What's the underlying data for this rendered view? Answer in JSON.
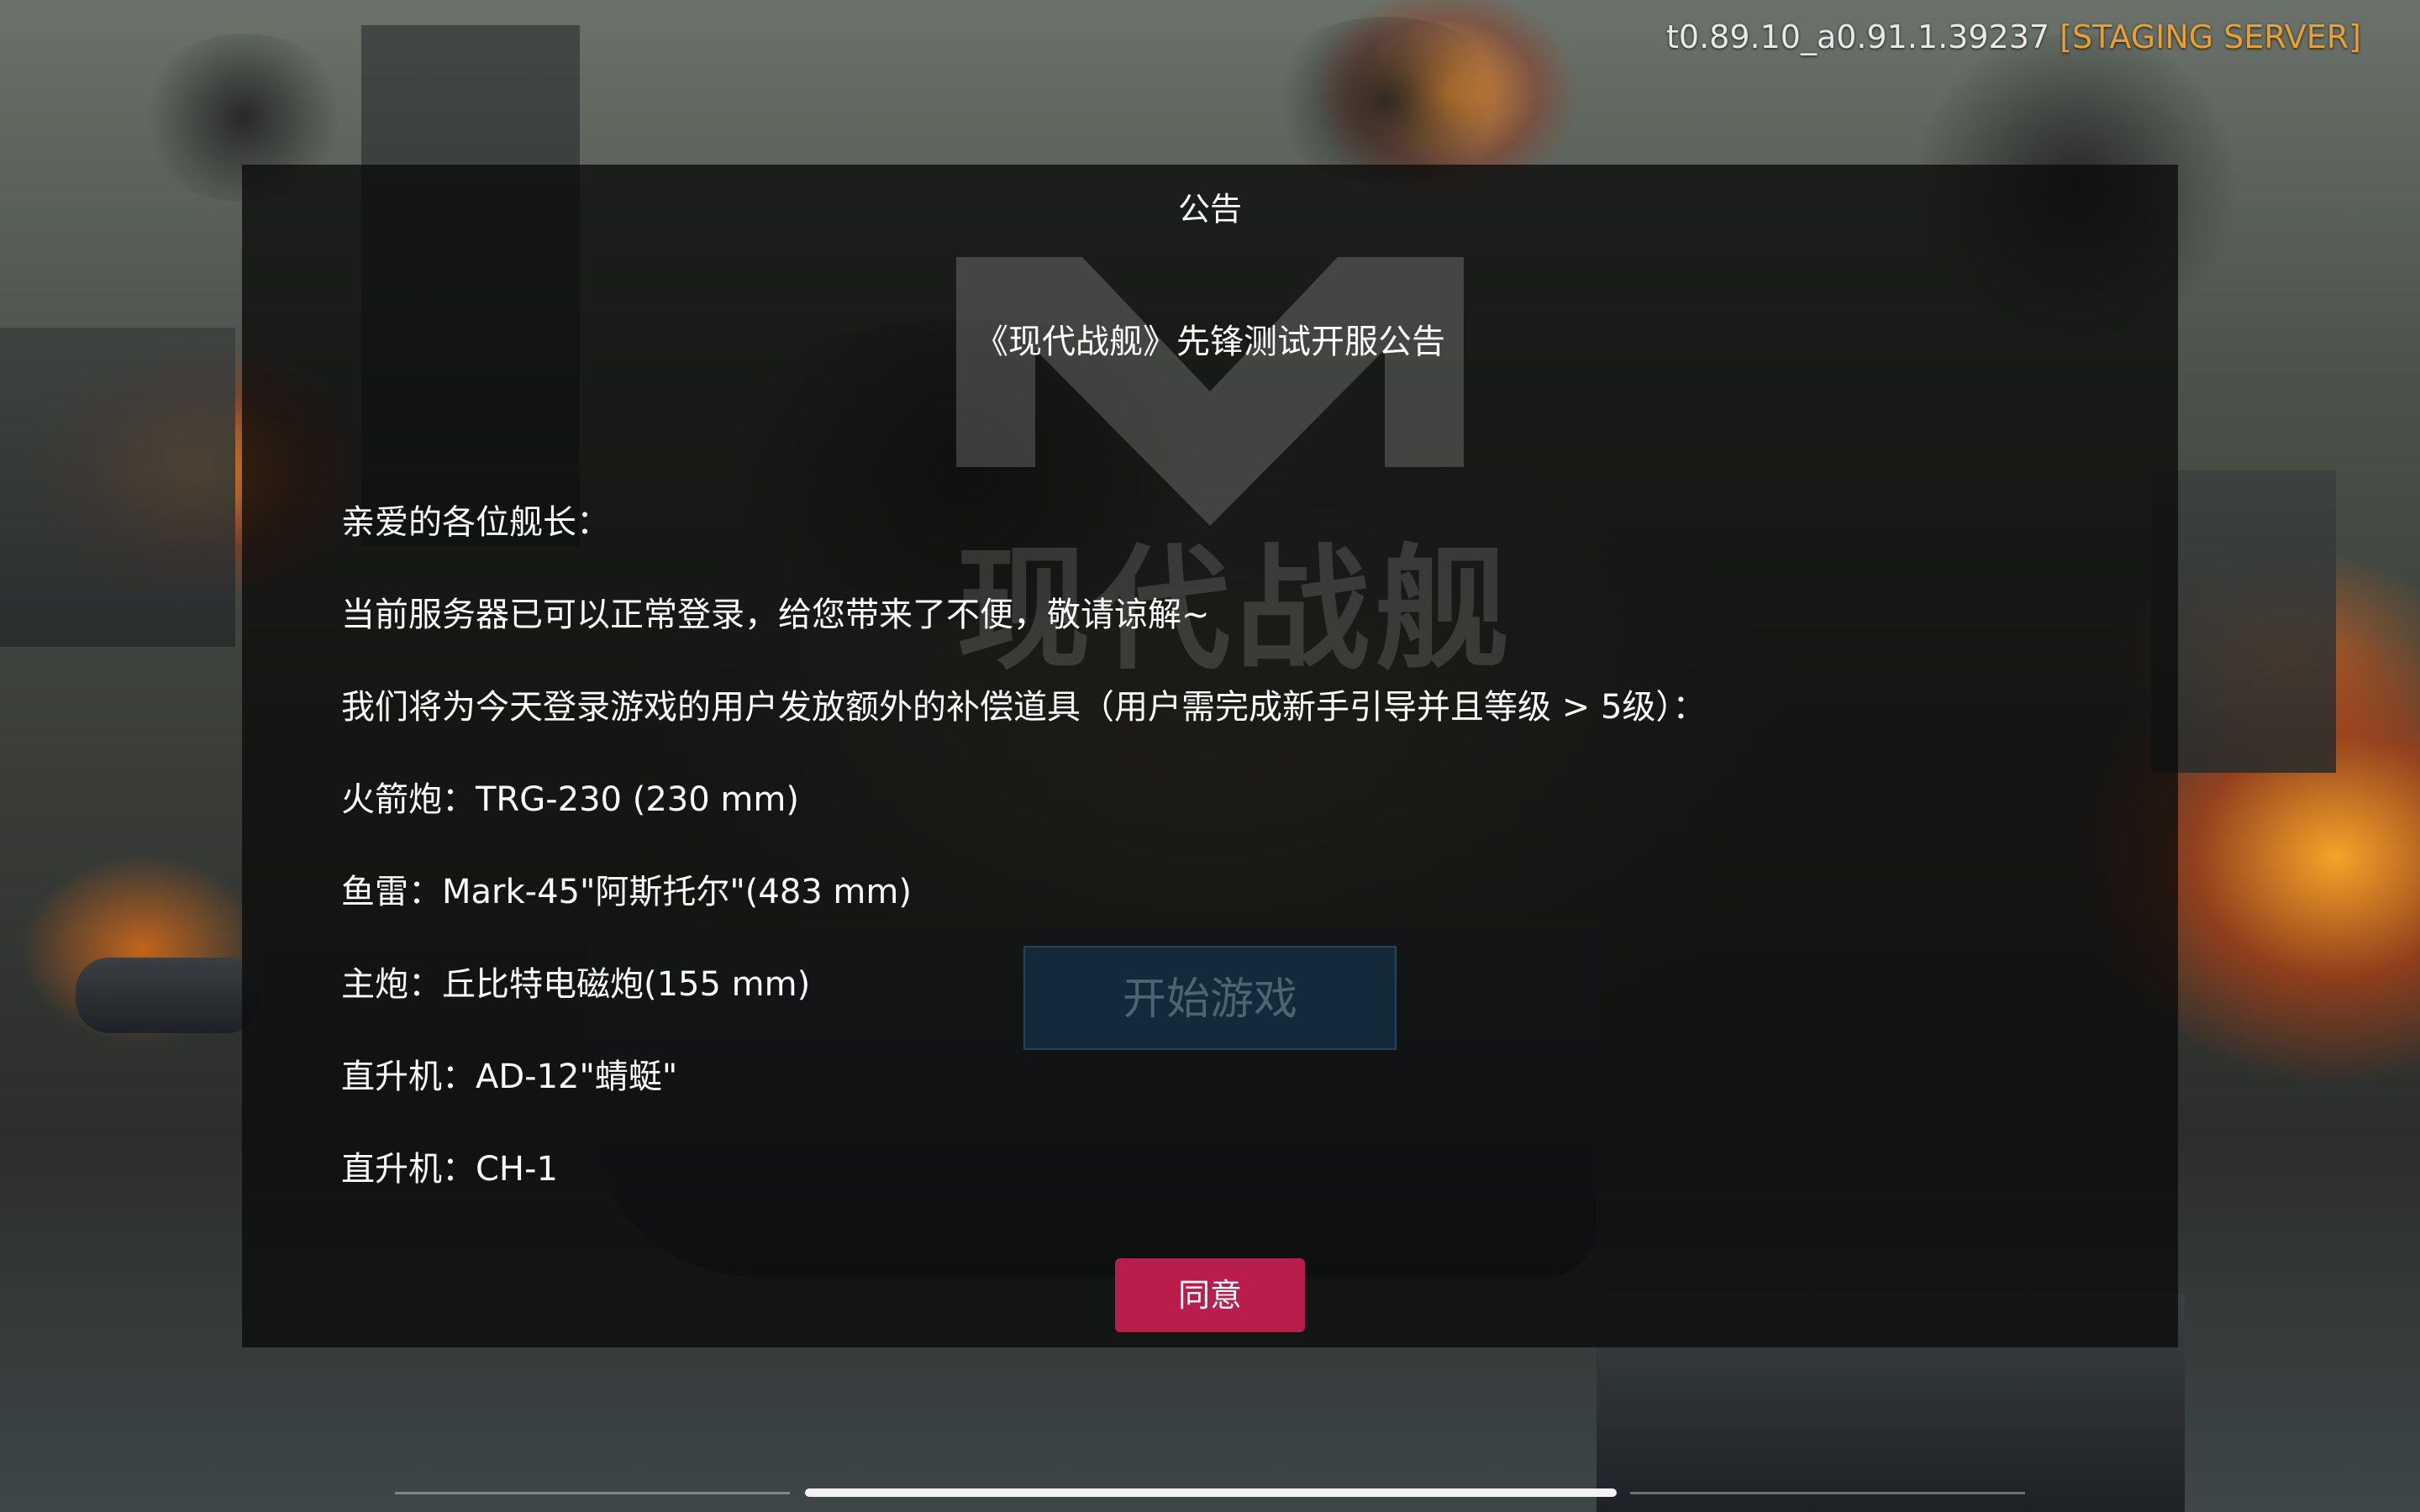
{
  "version": {
    "build": "t0.89.10_a0.91.1.39237",
    "server_tag": "[STAGING SERVER]"
  },
  "background": {
    "logo_text": "现代战舰",
    "start_button_label": "开始游戏"
  },
  "dialog": {
    "title": "公告",
    "heading": "《现代战舰》先锋测试开服公告",
    "lines": [
      "亲爱的各位舰长：",
      "当前服务器已可以正常登录，给您带来了不便，敬请谅解~",
      "我们将为今天登录游戏的用户发放额外的补偿道具（用户需完成新手引导并且等级 > 5级）：",
      "火箭炮：TRG-230 (230 mm)",
      "鱼雷：Mark-45\"阿斯托尔\"(483 mm)",
      "主炮：丘比特电磁炮(155 mm)",
      "直升机：AD-12\"蜻蜓\"",
      "直升机：CH-1"
    ],
    "agree_label": "同意"
  },
  "colors": {
    "agree_button": "#b81d4c",
    "server_tag": "#e8a030",
    "dialog_bg": "rgba(10,10,10,0.78)"
  }
}
